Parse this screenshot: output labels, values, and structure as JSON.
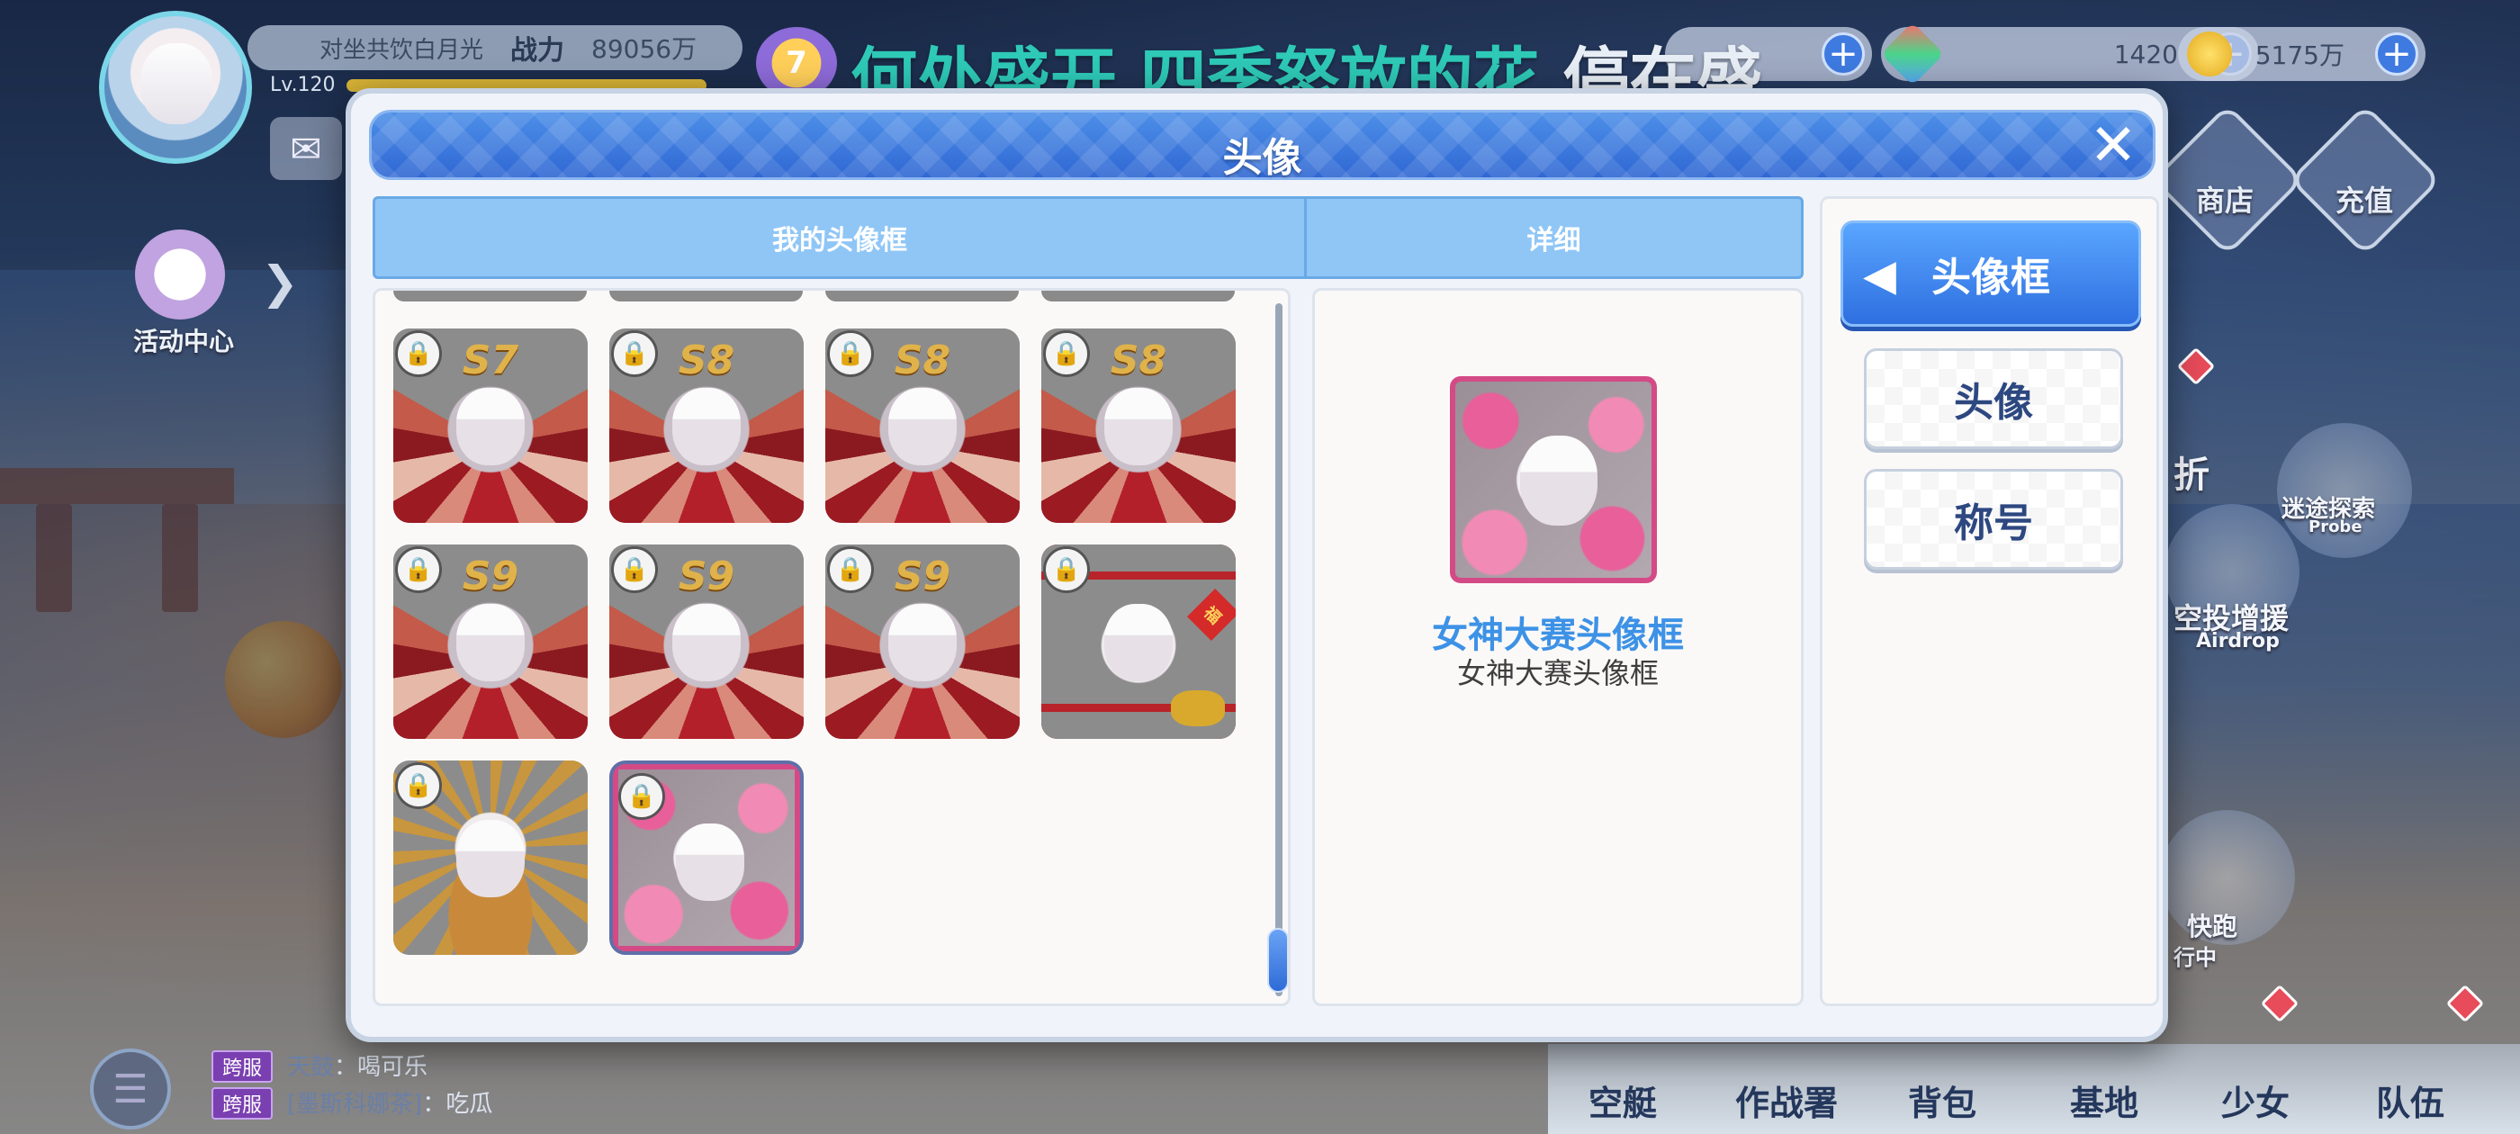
{
  "hud": {
    "player_name": "对坐共饮白月光",
    "power_label": "战力",
    "power_value": "89056万",
    "level": "Lv.120",
    "rank": "7",
    "gems": "1420",
    "coins": "5175万",
    "lyric_highlight": "何处盛开 四季怒放的花",
    "lyric_rest": " 停在盛",
    "activity_center": "活动中心"
  },
  "right_menu": {
    "shop": "商店",
    "recharge": "充值",
    "probe": "迷途探索",
    "probe_sub": "Probe",
    "airdrop": "空投增援",
    "airdrop_sub": "Airdrop",
    "run": "快跑",
    "run_sub": "行中",
    "partial": "折"
  },
  "chat": [
    {
      "tag": "跨服",
      "who": "天鼓",
      "msg": "：喝可乐"
    },
    {
      "tag": "跨服",
      "who": "[墨斯科娜茶]",
      "msg": "：吃瓜"
    }
  ],
  "nav": [
    "空艇",
    "作战署",
    "背包",
    "基地",
    "少女",
    "队伍"
  ],
  "dialog": {
    "title": "头像",
    "close": "✕",
    "tabs": [
      "我的头像框",
      "详细"
    ],
    "frames": [
      {
        "label": "S7",
        "locked": true,
        "style": "wing"
      },
      {
        "label": "S8",
        "locked": true,
        "style": "wing"
      },
      {
        "label": "S8",
        "locked": true,
        "style": "wing"
      },
      {
        "label": "S8",
        "locked": true,
        "style": "wing"
      },
      {
        "label": "S9",
        "locked": true,
        "style": "wing"
      },
      {
        "label": "S9",
        "locked": true,
        "style": "wing"
      },
      {
        "label": "S9",
        "locked": true,
        "style": "wing"
      },
      {
        "label": "",
        "locked": true,
        "style": "cny"
      },
      {
        "label": "",
        "locked": true,
        "style": "gold"
      },
      {
        "label": "",
        "locked": true,
        "style": "flower",
        "selected": true
      }
    ],
    "detail": {
      "name": "女神大赛头像框",
      "description": "女神大赛头像框"
    },
    "side_tabs": [
      "头像框",
      "头像",
      "称号"
    ]
  }
}
